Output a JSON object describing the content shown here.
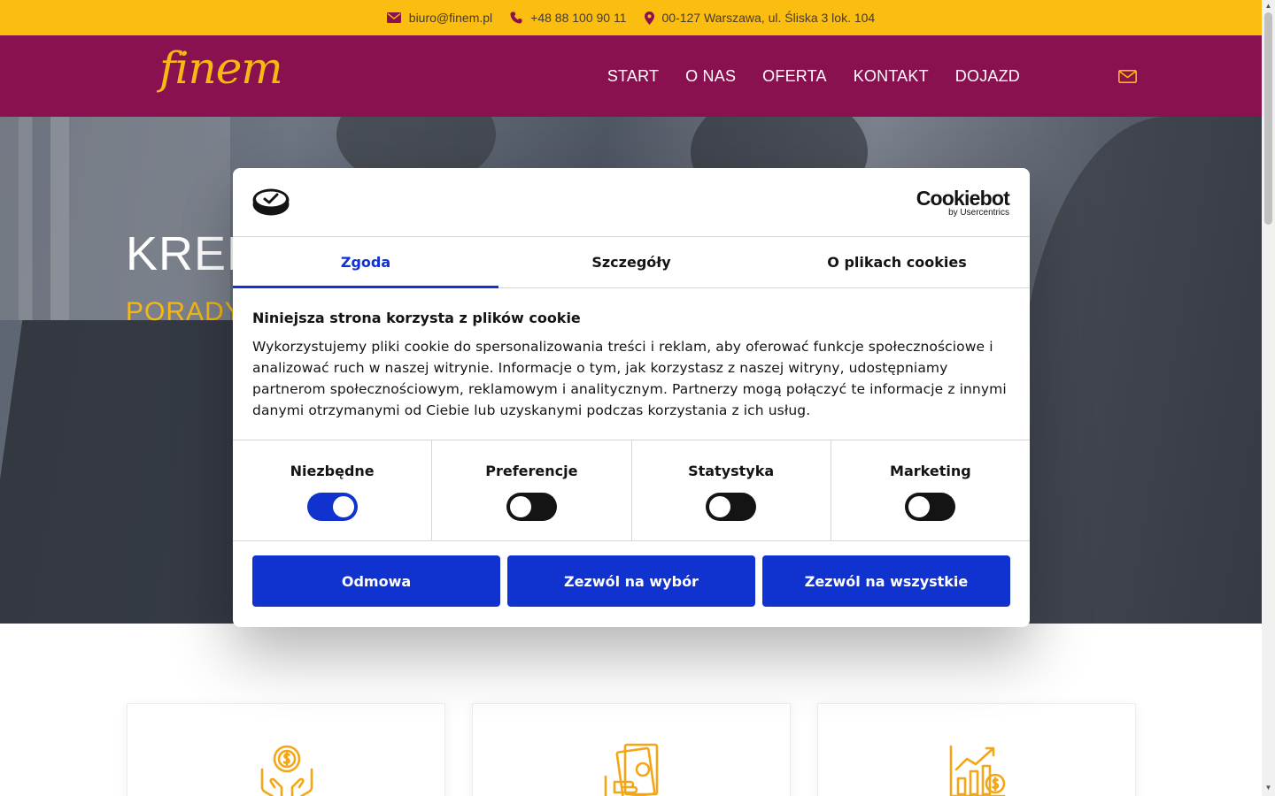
{
  "topbar": {
    "email": "biuro@finem.pl",
    "phone": "+48 88 100 90 11",
    "address": "00-127 Warszawa, ul. Śliska 3 lok. 104",
    "icons": [
      "envelope-icon",
      "phone-icon",
      "map-pin-icon"
    ]
  },
  "header": {
    "logo": "finem",
    "nav": [
      "START",
      "O NAS",
      "OFERTA",
      "KONTAKT",
      "DOJAZD"
    ],
    "mail_icon": "envelope-outline-icon"
  },
  "hero": {
    "title": "KRED",
    "subtitle": "PORADY"
  },
  "cookie_dialog": {
    "brand": "Cookiebot",
    "brand_sub": "by Usercentrics",
    "tabs": [
      "Zgoda",
      "Szczegóły",
      "O plikach cookies"
    ],
    "active_tab": "Zgoda",
    "heading": "Niniejsza strona korzysta z plików cookie",
    "text": "Wykorzystujemy pliki cookie do spersonalizowania treści i reklam, aby oferować funkcje społecznościowe i analizować ruch w naszej witrynie. Informacje o tym, jak korzystasz z naszej witryny, udostępniamy partnerom społecznościowym, reklamowym i analitycznym. Partnerzy mogą połączyć te informacje z innymi danymi otrzymanymi od Ciebie lub uzyskanymi podczas korzystania z ich usług.",
    "toggles": [
      {
        "label": "Niezbędne",
        "on": true
      },
      {
        "label": "Preferencje",
        "on": false
      },
      {
        "label": "Statystyka",
        "on": false
      },
      {
        "label": "Marketing",
        "on": false
      }
    ],
    "buttons": [
      "Odmowa",
      "Zezwól na wybór",
      "Zezwól na wszystkie"
    ]
  },
  "cards": {
    "icons": [
      "money-hands-icon",
      "cash-warning-icon",
      "growth-chart-icon"
    ]
  },
  "colors": {
    "topbar": "#fbbd0f",
    "header": "#8a1150",
    "accent": "#f7b813",
    "cookie_blue": "#1032cf"
  }
}
